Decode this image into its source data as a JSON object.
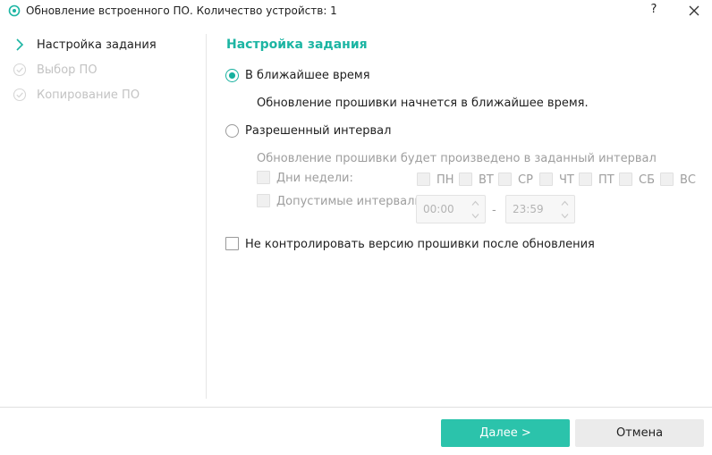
{
  "window": {
    "title": "Обновление встроенного ПО. Количество устройств: 1",
    "help_label": "?",
    "app_icon": "app-logo-icon",
    "close_icon": "close-icon"
  },
  "steps": [
    {
      "label": "Настройка задания",
      "state": "active",
      "icon": "chevron-right-icon"
    },
    {
      "label": "Выбор ПО",
      "state": "done",
      "icon": "check-circle-icon"
    },
    {
      "label": "Копирование ПО",
      "state": "done",
      "icon": "check-circle-icon"
    }
  ],
  "main": {
    "section_title": "Настройка задания",
    "option_asap": {
      "label": "В ближайшее время",
      "selected": true
    },
    "asap_description": "Обновление прошивки начнется в ближайшее время.",
    "option_interval": {
      "label": "Разрешенный интервал",
      "selected": false
    },
    "interval_description": "Обновление прошивки будет произведено в заданный интервал",
    "weekdays_label": "Дни недели:",
    "weekdays": [
      "ПН",
      "ВТ",
      "СР",
      "ЧТ",
      "ПТ",
      "СБ",
      "ВС"
    ],
    "intervals_label": "Допустимые интервалы",
    "time_from": "00:00",
    "time_separator": "-",
    "time_to": "23:59",
    "no_version_check_label": "Не контролировать версию прошивки после обновления"
  },
  "footer": {
    "next_label": "Далее >",
    "cancel_label": "Отмена"
  },
  "colors": {
    "accent": "#1cb5a3",
    "primary_button": "#2bc3ab",
    "secondary_button": "#ebebeb"
  }
}
